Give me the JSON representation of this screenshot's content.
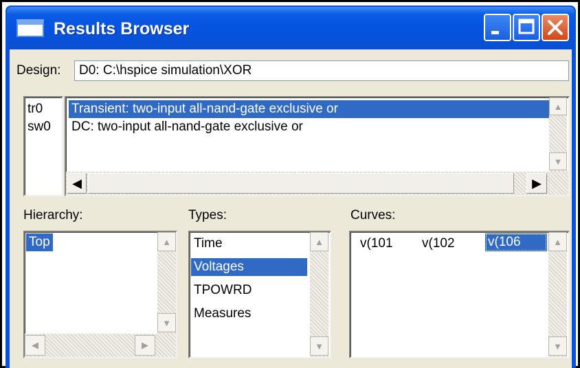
{
  "window": {
    "title": "Results Browser",
    "controls": {
      "minimize_icon": "minimize-icon",
      "maximize_icon": "maximize-icon",
      "close_icon": "close-icon"
    }
  },
  "design": {
    "label": "Design:",
    "value": "D0: C:\\hspice simulation\\XOR"
  },
  "analyses": {
    "items": [
      {
        "id": "tr0",
        "description": "Transient: two-input all-nand-gate exclusive or",
        "selected": true
      },
      {
        "id": "sw0",
        "description": "DC: two-input all-nand-gate exclusive or",
        "selected": false
      }
    ]
  },
  "hierarchy": {
    "label": "Hierarchy:",
    "items": [
      "Top"
    ],
    "selected": "Top"
  },
  "types": {
    "label": "Types:",
    "items": [
      "Time",
      "Voltages",
      "TPOWRD",
      "Measures"
    ],
    "selected": "Voltages"
  },
  "curves": {
    "label": "Curves:",
    "items": [
      "v(101",
      "v(102",
      "v(106"
    ],
    "selected": "v(106"
  },
  "colors": {
    "titlebar": "#0553e0",
    "selection": "#316ac5",
    "dialog_bg": "#ece9d8",
    "close_button": "#d2481a"
  }
}
